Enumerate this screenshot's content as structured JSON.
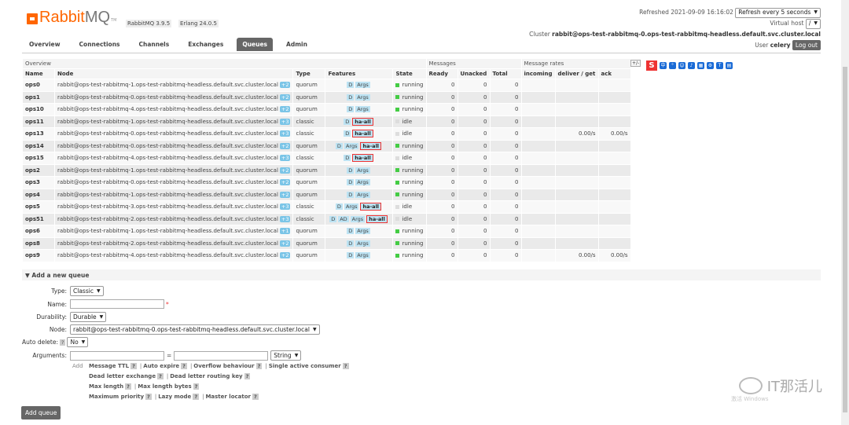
{
  "header": {
    "brand_rabbit": "Rabbit",
    "brand_mq": "MQ",
    "tm": "TM",
    "rabbitmq_version": "RabbitMQ 3.9.5",
    "erlang_version": "Erlang 24.0.5",
    "refreshed": "Refreshed 2021-09-09 16:16:02",
    "refresh_select": "Refresh every 5 seconds",
    "virtual_host_label": "Virtual host",
    "virtual_host_value": "/",
    "cluster_label": "Cluster",
    "cluster_value": "rabbit@ops-test-rabbitmq-0.ops-test-rabbitmq-headless.default.svc.cluster.local",
    "user_label": "User",
    "user_value": "celery",
    "logout": "Log out"
  },
  "tabs": [
    "Overview",
    "Connections",
    "Channels",
    "Exchanges",
    "Queues",
    "Admin"
  ],
  "active_tab": "Queues",
  "table": {
    "group_overview": "Overview",
    "group_messages": "Messages",
    "group_rates": "Message rates",
    "plus_minus": "+/-",
    "headers": [
      "Name",
      "Node",
      "Type",
      "Features",
      "State",
      "Ready",
      "Unacked",
      "Total",
      "incoming",
      "deliver / get",
      "ack"
    ],
    "rows": [
      {
        "name": "ops0",
        "node": "rabbit@ops-test-rabbitmq-1.ops-test-rabbitmq-headless.default.svc.cluster.local",
        "plus": "+2",
        "type": "quorum",
        "features": [
          "D",
          "Args"
        ],
        "ha": "",
        "state": "running",
        "ready": "0",
        "unacked": "0",
        "total": "0",
        "incoming": "",
        "deliver": "",
        "ack": ""
      },
      {
        "name": "ops1",
        "node": "rabbit@ops-test-rabbitmq-0.ops-test-rabbitmq-headless.default.svc.cluster.local",
        "plus": "+2",
        "type": "quorum",
        "features": [
          "D",
          "Args"
        ],
        "ha": "",
        "state": "running",
        "ready": "0",
        "unacked": "0",
        "total": "0",
        "incoming": "",
        "deliver": "",
        "ack": ""
      },
      {
        "name": "ops10",
        "node": "rabbit@ops-test-rabbitmq-4.ops-test-rabbitmq-headless.default.svc.cluster.local",
        "plus": "+2",
        "type": "quorum",
        "features": [
          "D",
          "Args"
        ],
        "ha": "",
        "state": "running",
        "ready": "0",
        "unacked": "0",
        "total": "0",
        "incoming": "",
        "deliver": "",
        "ack": ""
      },
      {
        "name": "ops11",
        "node": "rabbit@ops-test-rabbitmq-1.ops-test-rabbitmq-headless.default.svc.cluster.local",
        "plus": "+3",
        "type": "classic",
        "features": [
          "D"
        ],
        "ha": "ha-all",
        "state": "idle",
        "ready": "0",
        "unacked": "0",
        "total": "0",
        "incoming": "",
        "deliver": "",
        "ack": ""
      },
      {
        "name": "ops13",
        "node": "rabbit@ops-test-rabbitmq-0.ops-test-rabbitmq-headless.default.svc.cluster.local",
        "plus": "+3",
        "type": "classic",
        "features": [
          "D"
        ],
        "ha": "ha-all",
        "state": "idle",
        "ready": "0",
        "unacked": "0",
        "total": "0",
        "incoming": "",
        "deliver": "0.00/s",
        "ack": "0.00/s"
      },
      {
        "name": "ops14",
        "node": "rabbit@ops-test-rabbitmq-0.ops-test-rabbitmq-headless.default.svc.cluster.local",
        "plus": "+2",
        "type": "quorum",
        "features": [
          "D",
          "Args"
        ],
        "ha": "ha-all",
        "state": "running",
        "ready": "0",
        "unacked": "0",
        "total": "0",
        "incoming": "",
        "deliver": "",
        "ack": ""
      },
      {
        "name": "ops15",
        "node": "rabbit@ops-test-rabbitmq-4.ops-test-rabbitmq-headless.default.svc.cluster.local",
        "plus": "+3",
        "type": "classic",
        "features": [
          "D"
        ],
        "ha": "ha-all",
        "state": "idle",
        "ready": "0",
        "unacked": "0",
        "total": "0",
        "incoming": "",
        "deliver": "",
        "ack": ""
      },
      {
        "name": "ops2",
        "node": "rabbit@ops-test-rabbitmq-1.ops-test-rabbitmq-headless.default.svc.cluster.local",
        "plus": "+2",
        "type": "quorum",
        "features": [
          "D",
          "Args"
        ],
        "ha": "",
        "state": "running",
        "ready": "0",
        "unacked": "0",
        "total": "0",
        "incoming": "",
        "deliver": "",
        "ack": ""
      },
      {
        "name": "ops3",
        "node": "rabbit@ops-test-rabbitmq-0.ops-test-rabbitmq-headless.default.svc.cluster.local",
        "plus": "+2",
        "type": "quorum",
        "features": [
          "D",
          "Args"
        ],
        "ha": "",
        "state": "running",
        "ready": "0",
        "unacked": "0",
        "total": "0",
        "incoming": "",
        "deliver": "",
        "ack": ""
      },
      {
        "name": "ops4",
        "node": "rabbit@ops-test-rabbitmq-1.ops-test-rabbitmq-headless.default.svc.cluster.local",
        "plus": "+2",
        "type": "quorum",
        "features": [
          "D",
          "Args"
        ],
        "ha": "",
        "state": "running",
        "ready": "0",
        "unacked": "0",
        "total": "0",
        "incoming": "",
        "deliver": "",
        "ack": ""
      },
      {
        "name": "ops5",
        "node": "rabbit@ops-test-rabbitmq-3.ops-test-rabbitmq-headless.default.svc.cluster.local",
        "plus": "+3",
        "type": "classic",
        "features": [
          "D",
          "Args"
        ],
        "ha": "ha-all",
        "state": "idle",
        "ready": "0",
        "unacked": "0",
        "total": "0",
        "incoming": "",
        "deliver": "",
        "ack": ""
      },
      {
        "name": "ops51",
        "node": "rabbit@ops-test-rabbitmq-2.ops-test-rabbitmq-headless.default.svc.cluster.local",
        "plus": "+3",
        "type": "classic",
        "features": [
          "D",
          "AD",
          "Args"
        ],
        "ha": "ha-all",
        "state": "idle",
        "ready": "0",
        "unacked": "0",
        "total": "0",
        "incoming": "",
        "deliver": "",
        "ack": ""
      },
      {
        "name": "ops6",
        "node": "rabbit@ops-test-rabbitmq-1.ops-test-rabbitmq-headless.default.svc.cluster.local",
        "plus": "+1",
        "type": "quorum",
        "features": [
          "D",
          "Args"
        ],
        "ha": "",
        "state": "running",
        "ready": "0",
        "unacked": "0",
        "total": "0",
        "incoming": "",
        "deliver": "",
        "ack": ""
      },
      {
        "name": "ops8",
        "node": "rabbit@ops-test-rabbitmq-2.ops-test-rabbitmq-headless.default.svc.cluster.local",
        "plus": "+2",
        "type": "quorum",
        "features": [
          "D",
          "Args"
        ],
        "ha": "",
        "state": "running",
        "ready": "0",
        "unacked": "0",
        "total": "0",
        "incoming": "",
        "deliver": "",
        "ack": ""
      },
      {
        "name": "ops9",
        "node": "rabbit@ops-test-rabbitmq-4.ops-test-rabbitmq-headless.default.svc.cluster.local",
        "plus": "+2",
        "type": "quorum",
        "features": [
          "D",
          "Args"
        ],
        "ha": "",
        "state": "running",
        "ready": "0",
        "unacked": "0",
        "total": "0",
        "incoming": "",
        "deliver": "0.00/s",
        "ack": "0.00/s"
      }
    ]
  },
  "add_queue": {
    "section_title": "Add a new queue",
    "type_label": "Type:",
    "type_value": "Classic",
    "name_label": "Name:",
    "name_value": "",
    "required_mark": "*",
    "durability_label": "Durability:",
    "durability_value": "Durable",
    "node_label": "Node:",
    "node_value": "rabbit@ops-test-rabbitmq-0.ops-test-rabbitmq-headless.default.svc.cluster.local",
    "auto_delete_label": "Auto delete:",
    "auto_delete_help": "?",
    "auto_delete_value": "No",
    "arguments_label": "Arguments:",
    "equals": "=",
    "arg_type_value": "String",
    "add_label": "Add",
    "arg_lines": [
      [
        "Message TTL",
        "Auto expire",
        "Overflow behaviour",
        "Single active consumer"
      ],
      [
        "Dead letter exchange",
        "Dead letter routing key"
      ],
      [
        "Max length",
        "Max length bytes"
      ],
      [
        "Maximum priority",
        "Lazy mode",
        "Master locator"
      ]
    ],
    "submit": "Add queue"
  },
  "overlay": {
    "watermark_text": "IT那活儿",
    "activate_text": "激活 Windows"
  },
  "colors": {
    "brand_orange": "#ff6600",
    "running": "#44cc44",
    "highlight_box": "#ee3333",
    "feature_bg": "#bde3f3",
    "plus_bg": "#7bc5e7"
  }
}
